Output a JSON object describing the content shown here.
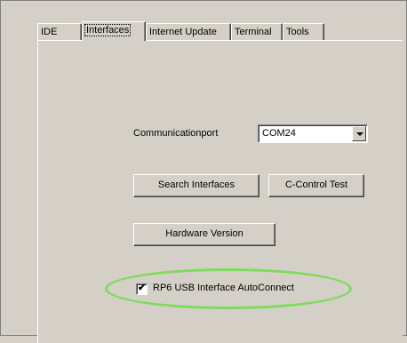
{
  "tabs": [
    {
      "label": "IDE"
    },
    {
      "label": "Interfaces"
    },
    {
      "label": "Internet Update"
    },
    {
      "label": "Terminal"
    },
    {
      "label": "Tools"
    }
  ],
  "active_tab": "Interfaces",
  "interfaces": {
    "port_label": "Communicationport",
    "port_value": "COM24",
    "search_button": "Search Interfaces",
    "test_button": "C-Control Test",
    "hardware_button": "Hardware Version",
    "autoconnect_label": "RP6 USB Interface AutoConnect",
    "autoconnect_checked": true
  },
  "highlight_color": "#7ddc5b"
}
